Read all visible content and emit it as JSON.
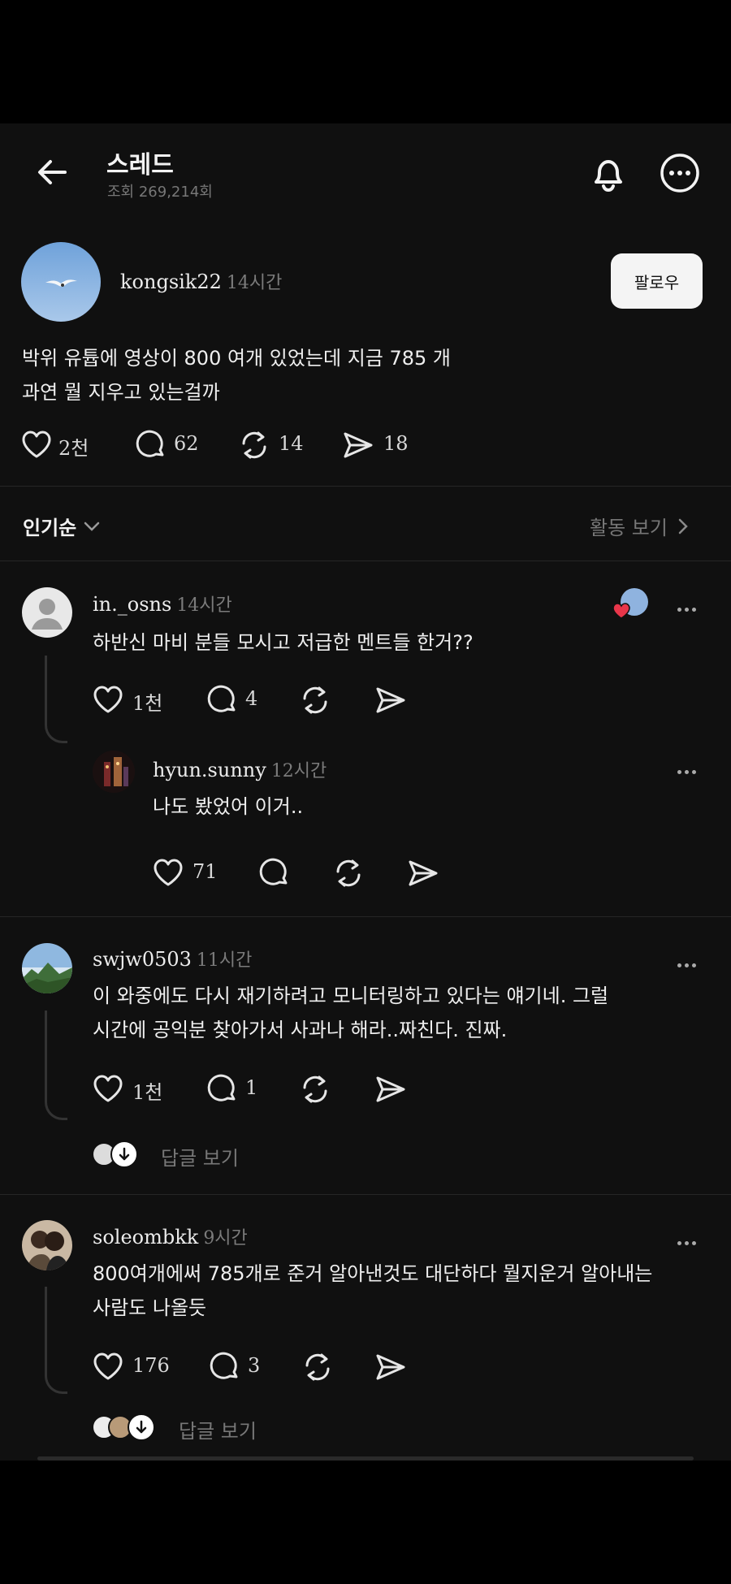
{
  "header": {
    "title": "스레드",
    "views": "조회 269,214회"
  },
  "post": {
    "username": "kongsik22",
    "time": "14시간",
    "follow_label": "팔로우",
    "text_line1": "박위 유튭에 영상이 800 여개 있었는데 지금 785 개",
    "text_line2": "과연 뭘 지우고 있는걸까",
    "likes": "2천",
    "comments": "62",
    "reposts": "14",
    "shares": "18"
  },
  "sort": {
    "label": "인기순",
    "activity": "활동 보기"
  },
  "comments": [
    {
      "username": "in._osns",
      "time": "14시간",
      "text_line1": "하반신 마비 분들 모시고 저급한 멘트들 한거??",
      "likes": "1천",
      "replies": "4"
    },
    {
      "username": "hyun.sunny",
      "time": "12시간",
      "text_line1": "나도 봤었어 이거..",
      "likes": "71"
    },
    {
      "username": "swjw0503",
      "time": "11시간",
      "text_line1": "이 와중에도 다시 재기하려고 모니터링하고 있다는 얘기네. 그럴",
      "text_line2": "시간에 공익분 찾아가서 사과나 해라..짜친다. 진짜.",
      "likes": "1천",
      "replies": "1",
      "view_replies": "답글 보기"
    },
    {
      "username": "soleombkk",
      "time": "9시간",
      "text_line1": "800여개에써 785개로 준거 알아낸것도 대단하다 뭘지운거 알아내는",
      "text_line2": "사람도 나올듯",
      "likes": "176",
      "replies": "3",
      "view_replies": "답글 보기"
    }
  ],
  "icons": {
    "back": "back-arrow-icon",
    "bell": "bell-icon",
    "more": "more-icon",
    "heart": "heart-icon",
    "comment": "comment-icon",
    "repost": "repost-icon",
    "share": "share-icon"
  },
  "colors": {
    "background": "#101010",
    "text": "#f3f3f3",
    "muted": "#7b7b7b",
    "like_red": "#e8364a"
  }
}
